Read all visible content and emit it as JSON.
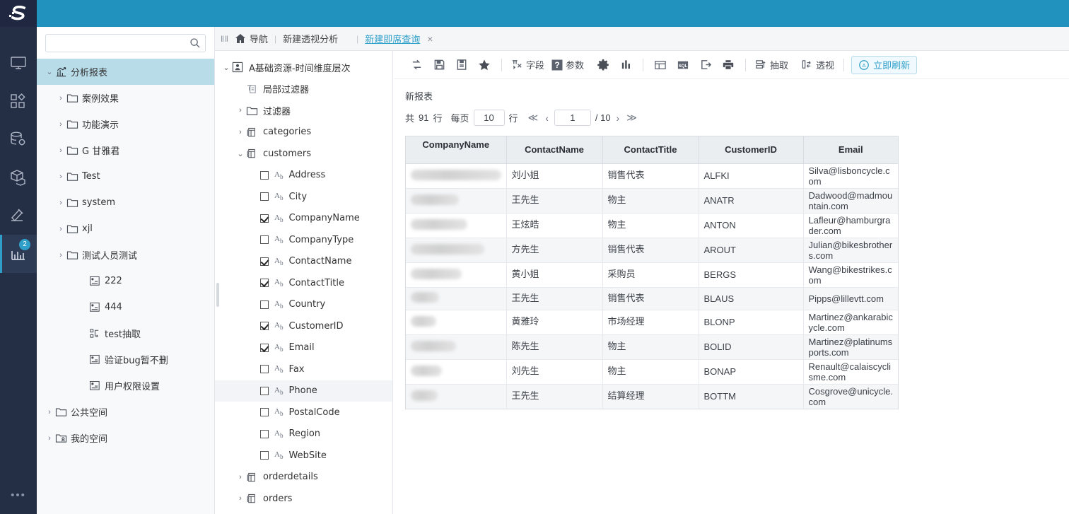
{
  "brand": {
    "logo_text": "S",
    "accent": "#2e9fc9",
    "topbar_color": "#2191bd",
    "rail_color": "#242f45"
  },
  "rail": {
    "items": [
      {
        "name": "monitor-icon",
        "label": "首页",
        "badge": ""
      },
      {
        "name": "apps-icon",
        "label": "应用",
        "badge": ""
      },
      {
        "name": "database-gear-icon",
        "label": "数据",
        "badge": ""
      },
      {
        "name": "cube-icon",
        "label": "模型",
        "badge": ""
      },
      {
        "name": "hammer-icon",
        "label": "工具",
        "badge": ""
      },
      {
        "name": "bar-chart-icon",
        "label": "分析",
        "badge": "2"
      }
    ],
    "more_label": "•••"
  },
  "sidebar": {
    "search": {
      "value": "",
      "placeholder": ""
    },
    "tree": [
      {
        "label": "分析报表",
        "level": 1,
        "arrow": "down",
        "icon": "chart-icon",
        "selected": true
      },
      {
        "label": "案例效果",
        "level": 2,
        "arrow": "right",
        "icon": "folder-icon",
        "selected": false
      },
      {
        "label": "功能演示",
        "level": 2,
        "arrow": "right",
        "icon": "folder-icon",
        "selected": false
      },
      {
        "label": "G 甘雅君",
        "level": 2,
        "arrow": "right",
        "icon": "folder-icon",
        "selected": false
      },
      {
        "label": "Test",
        "level": 2,
        "arrow": "right",
        "icon": "folder-icon",
        "selected": false
      },
      {
        "label": "system",
        "level": 2,
        "arrow": "right",
        "icon": "folder-icon",
        "selected": false
      },
      {
        "label": "xjl",
        "level": 2,
        "arrow": "right",
        "icon": "folder-icon",
        "selected": false
      },
      {
        "label": "测试人员测试",
        "level": 2,
        "arrow": "right",
        "icon": "folder-icon",
        "selected": false
      },
      {
        "label": "222",
        "level": 3,
        "arrow": "",
        "icon": "report-icon",
        "selected": false
      },
      {
        "label": "444",
        "level": 3,
        "arrow": "",
        "icon": "report-icon",
        "selected": false
      },
      {
        "label": "test抽取",
        "level": 3,
        "arrow": "",
        "icon": "extract-icon",
        "selected": false
      },
      {
        "label": "验证bug暂不删",
        "level": 3,
        "arrow": "",
        "icon": "report-icon",
        "selected": false
      },
      {
        "label": "用户权限设置",
        "level": 3,
        "arrow": "",
        "icon": "report-icon",
        "selected": false
      },
      {
        "label": "公共空间",
        "level": 1,
        "arrow": "right",
        "icon": "folder-icon",
        "selected": false
      },
      {
        "label": "我的空间",
        "level": 1,
        "arrow": "right",
        "icon": "folder-user-icon",
        "selected": false
      }
    ]
  },
  "breadcrumb": {
    "grip": "‖‖",
    "home_label": "导航",
    "sep": "|",
    "item2": "新建透视分析",
    "sep2": "|",
    "active_tab": "新建即席查询",
    "close": "×"
  },
  "dataset_tree": {
    "rows": [
      {
        "label": "A基础资源-时间维度层次",
        "indent": 1,
        "arrow": "down",
        "icon": "dataset-icon",
        "checkbox": "none",
        "highlighted": false
      },
      {
        "label": "局部过滤器",
        "indent": 2,
        "arrow": "",
        "icon": "filter-icon",
        "checkbox": "none",
        "highlighted": false
      },
      {
        "label": "过滤器",
        "indent": 2,
        "arrow": "right",
        "icon": "folder-icon",
        "checkbox": "none",
        "highlighted": false
      },
      {
        "label": "categories",
        "indent": 2,
        "arrow": "right",
        "icon": "table-icon",
        "checkbox": "none",
        "highlighted": false
      },
      {
        "label": "customers",
        "indent": 2,
        "arrow": "down",
        "icon": "table-icon",
        "checkbox": "none",
        "highlighted": false
      },
      {
        "label": "Address",
        "indent": 4,
        "arrow": "",
        "icon": "ab-icon",
        "checkbox": "off",
        "highlighted": false
      },
      {
        "label": "City",
        "indent": 4,
        "arrow": "",
        "icon": "ab-icon",
        "checkbox": "off",
        "highlighted": false
      },
      {
        "label": "CompanyName",
        "indent": 4,
        "arrow": "",
        "icon": "ab-icon",
        "checkbox": "on",
        "highlighted": false
      },
      {
        "label": "CompanyType",
        "indent": 4,
        "arrow": "",
        "icon": "ab-icon",
        "checkbox": "off",
        "highlighted": false
      },
      {
        "label": "ContactName",
        "indent": 4,
        "arrow": "",
        "icon": "ab-icon",
        "checkbox": "on",
        "highlighted": false
      },
      {
        "label": "ContactTitle",
        "indent": 4,
        "arrow": "",
        "icon": "ab-icon",
        "checkbox": "on",
        "highlighted": false
      },
      {
        "label": "Country",
        "indent": 4,
        "arrow": "",
        "icon": "ab-icon",
        "checkbox": "off",
        "highlighted": false
      },
      {
        "label": "CustomerID",
        "indent": 4,
        "arrow": "",
        "icon": "ab-icon",
        "checkbox": "on",
        "highlighted": false
      },
      {
        "label": "Email",
        "indent": 4,
        "arrow": "",
        "icon": "ab-icon",
        "checkbox": "on",
        "highlighted": false
      },
      {
        "label": "Fax",
        "indent": 4,
        "arrow": "",
        "icon": "ab-icon",
        "checkbox": "off",
        "highlighted": false
      },
      {
        "label": "Phone",
        "indent": 4,
        "arrow": "",
        "icon": "ab-icon",
        "checkbox": "off",
        "highlighted": true
      },
      {
        "label": "PostalCode",
        "indent": 4,
        "arrow": "",
        "icon": "ab-icon",
        "checkbox": "off",
        "highlighted": false
      },
      {
        "label": "Region",
        "indent": 4,
        "arrow": "",
        "icon": "ab-icon",
        "checkbox": "off",
        "highlighted": false
      },
      {
        "label": "WebSite",
        "indent": 4,
        "arrow": "",
        "icon": "ab-icon",
        "checkbox": "off",
        "highlighted": false
      },
      {
        "label": "orderdetails",
        "indent": 2,
        "arrow": "right",
        "icon": "table-icon",
        "checkbox": "none",
        "highlighted": false
      },
      {
        "label": "orders",
        "indent": 2,
        "arrow": "right",
        "icon": "table-icon",
        "checkbox": "none",
        "highlighted": false
      }
    ]
  },
  "toolbar": {
    "buttons": [
      {
        "name": "undo-redo-icon",
        "label": "",
        "icon": "swap"
      },
      {
        "name": "save-icon",
        "label": "",
        "icon": "save"
      },
      {
        "name": "save-as-icon",
        "label": "",
        "icon": "saveas"
      },
      {
        "name": "favorite-icon",
        "label": "",
        "icon": "star"
      },
      {
        "name": "field-button",
        "label": "字段",
        "icon": "field"
      },
      {
        "name": "parameter-button",
        "label": "参数",
        "icon": "param"
      },
      {
        "name": "settings-icon",
        "label": "",
        "icon": "gear"
      },
      {
        "name": "chart-icon",
        "label": "",
        "icon": "chart"
      },
      {
        "name": "layout-icon",
        "label": "",
        "icon": "layout"
      },
      {
        "name": "sql-icon",
        "label": "",
        "icon": "sql"
      },
      {
        "name": "export-icon",
        "label": "",
        "icon": "export"
      },
      {
        "name": "print-icon",
        "label": "",
        "icon": "print"
      },
      {
        "name": "extract-button",
        "label": "抽取",
        "icon": "extract"
      },
      {
        "name": "pivot-button",
        "label": "透视",
        "icon": "pivot"
      }
    ],
    "refresh_label": "立即刷新"
  },
  "report": {
    "title": "新报表",
    "pager": {
      "total_prefix": "共",
      "total_rows": "91",
      "row_unit": "行",
      "per_page_label": "每页",
      "per_page_value": "10",
      "per_page_unit": "行",
      "first": "≪",
      "prev": "‹",
      "page_value": "1",
      "page_of": "/ 10",
      "next": "›",
      "last": "≫"
    },
    "table": {
      "columns": [
        "CompanyName",
        "ContactName",
        "ContactTitle",
        "CustomerID",
        "Email"
      ],
      "rows": [
        {
          "CompanyName": "",
          "redact_width": 128,
          "ContactName": "刘小姐",
          "ContactTitle": "销售代表",
          "CustomerID": "ALFKI",
          "Email": "Silva@lisboncycle.com"
        },
        {
          "CompanyName": "",
          "redact_width": 68,
          "ContactName": "王先生",
          "ContactTitle": "物主",
          "CustomerID": "ANATR",
          "Email": "Dadwood@madmountain.com"
        },
        {
          "CompanyName": "",
          "redact_width": 80,
          "ContactName": "王炫皓",
          "ContactTitle": "物主",
          "CustomerID": "ANTON",
          "Email": "Lafleur@hamburgrader.com"
        },
        {
          "CompanyName": "",
          "redact_width": 104,
          "ContactName": "方先生",
          "ContactTitle": "销售代表",
          "CustomerID": "AROUT",
          "Email": "Julian@bikesbrothers.com"
        },
        {
          "CompanyName": "",
          "redact_width": 72,
          "ContactName": "黄小姐",
          "ContactTitle": "采购员",
          "CustomerID": "BERGS",
          "Email": "Wang@bikestrikes.com"
        },
        {
          "CompanyName": "",
          "redact_width": 40,
          "ContactName": "王先生",
          "ContactTitle": "销售代表",
          "CustomerID": "BLAUS",
          "Email": "Pipps@lillevtt.com"
        },
        {
          "CompanyName": "",
          "redact_width": 36,
          "ContactName": "黄雅玲",
          "ContactTitle": "市场经理",
          "CustomerID": "BLONP",
          "Email": "Martinez@ankarabicycle.com"
        },
        {
          "CompanyName": "",
          "redact_width": 64,
          "ContactName": "陈先生",
          "ContactTitle": "物主",
          "CustomerID": "BOLID",
          "Email": "Martinez@platinumsports.com"
        },
        {
          "CompanyName": "",
          "redact_width": 44,
          "ContactName": "刘先生",
          "ContactTitle": "物主",
          "CustomerID": "BONAP",
          "Email": "Renault@calaiscyclisme.com"
        },
        {
          "CompanyName": "",
          "redact_width": 38,
          "ContactName": "王先生",
          "ContactTitle": "结算经理",
          "CustomerID": "BOTTM",
          "Email": "Cosgrove@unicycle.com"
        }
      ]
    }
  }
}
